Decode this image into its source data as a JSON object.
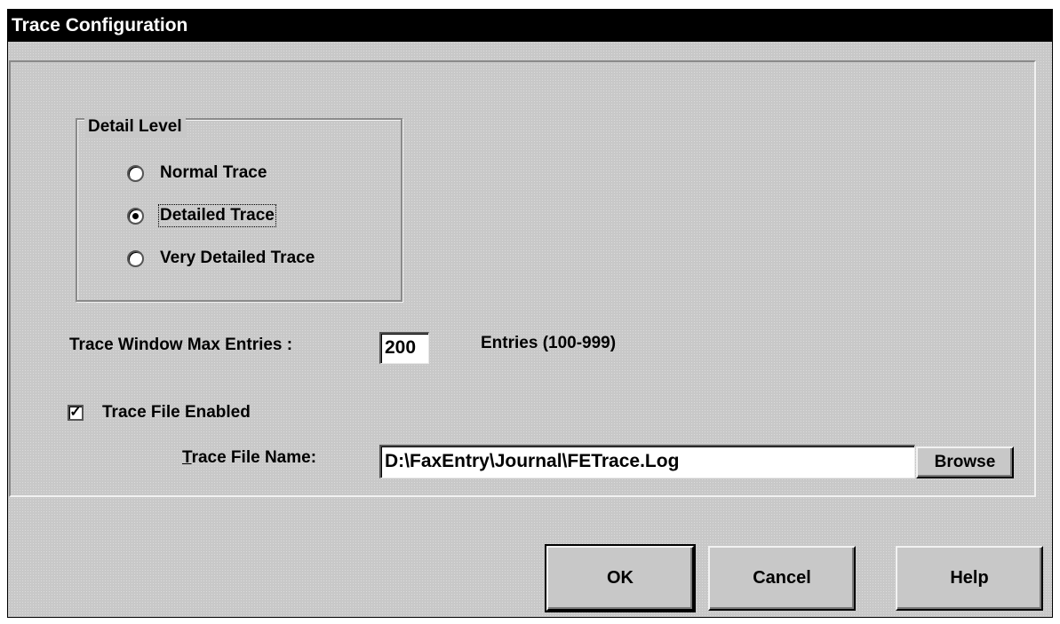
{
  "window": {
    "title": "Trace Configuration"
  },
  "detail_level": {
    "label": "Detail Level",
    "options": [
      {
        "label": "Normal Trace",
        "checked": false
      },
      {
        "label": "Detailed Trace",
        "checked": true
      },
      {
        "label": "Very Detailed Trace",
        "checked": false
      }
    ]
  },
  "max_entries": {
    "label": "Trace Window Max Entries :",
    "value": "200",
    "unit_hint": "Entries (100-999)"
  },
  "trace_file": {
    "enabled_label": "Trace File Enabled",
    "enabled": true,
    "check_mark": "✓",
    "name_label_accel": "T",
    "name_label_rest": "race File Name:",
    "name_value": "D:\\FaxEntry\\Journal\\FETrace.Log",
    "browse_label": "Browse"
  },
  "buttons": {
    "ok": "OK",
    "cancel": "Cancel",
    "help": "Help"
  }
}
